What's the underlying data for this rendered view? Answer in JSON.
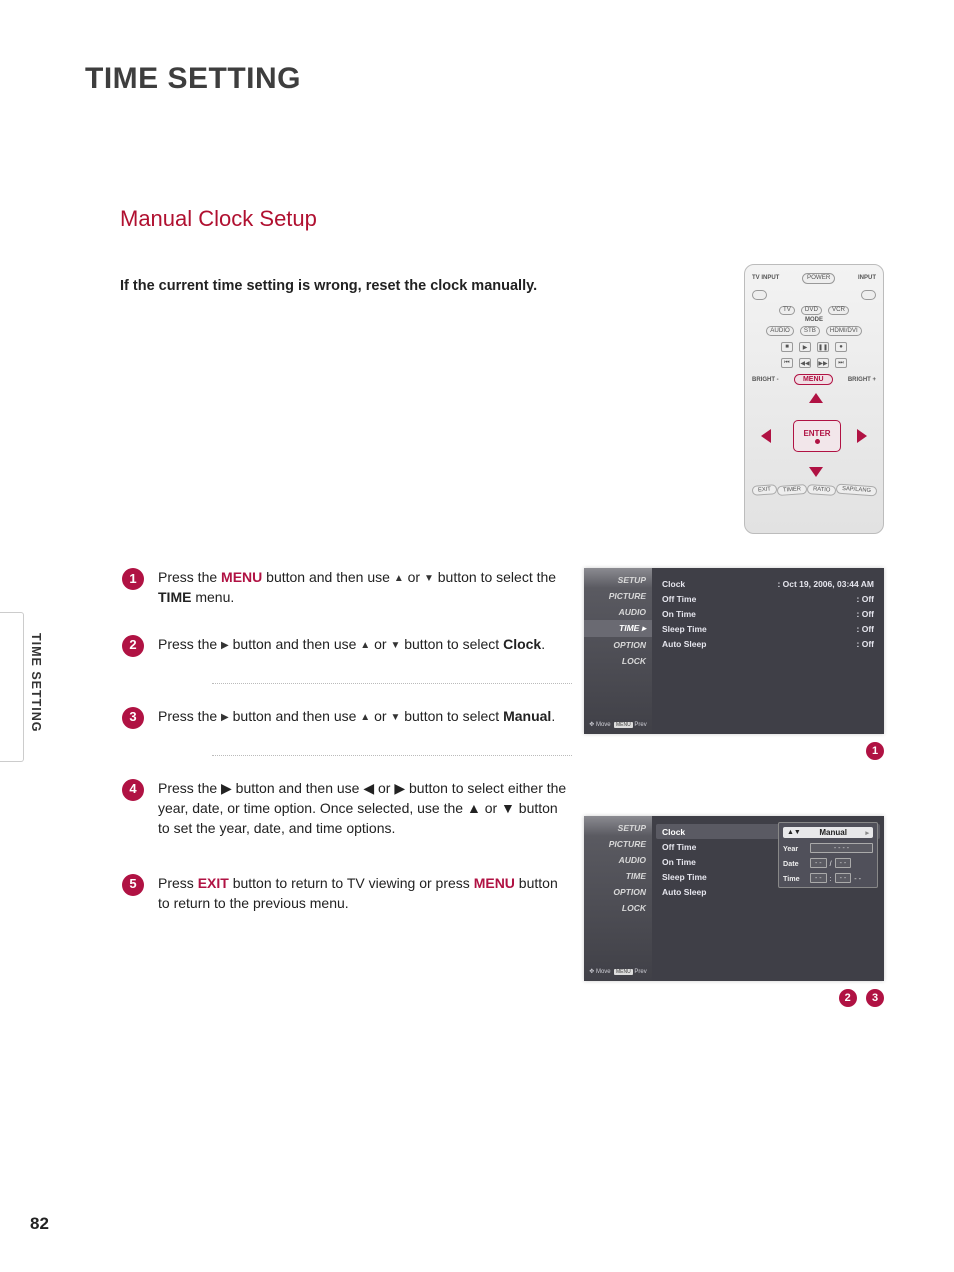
{
  "page": {
    "title": "TIME SETTING",
    "subtitle": "Manual Clock Setup",
    "intro": "If the current time setting is wrong, reset the clock manually.",
    "sidebar_label": "TIME SETTING",
    "page_number": "82"
  },
  "steps": [
    {
      "n": "1",
      "pre": "Press the ",
      "hl": "MENU",
      "mid": " button and then use ",
      "post": " button to select the ",
      "bold": "TIME",
      "tail": " menu."
    },
    {
      "n": "2",
      "pre": "Press the ",
      "mid": " button and then use ",
      "post": " button to select ",
      "bold": "Clock",
      "tail": "."
    },
    {
      "n": "3",
      "pre": "Press the ",
      "mid": " button and then use ",
      "post": " button to select ",
      "bold": "Manual",
      "tail": "."
    },
    {
      "n": "4",
      "text": "Press the ▶ button and then use ◀ or ▶ button to select either the year, date, or time option. Once selected, use the ▲ or ▼ button to set the year, date, and time options."
    },
    {
      "n": "5",
      "pre": "Press ",
      "hl": "EXIT",
      "mid": " button to return to TV viewing or press ",
      "hl2": "MENU",
      "tail": " button to return to the previous menu."
    }
  ],
  "remote": {
    "top_left": "TV INPUT",
    "power": "POWER",
    "top_right": "INPUT",
    "mode": "MODE",
    "row2": [
      "TV",
      "DVD",
      "VCR"
    ],
    "row3": [
      "AUDIO",
      "STB",
      "HDMI/DVI"
    ],
    "bright_minus": "BRIGHT -",
    "menu": "MENU",
    "bright_plus": "BRIGHT +",
    "enter": "ENTER",
    "bottom": [
      "EXIT",
      "TIMER",
      "RATIO",
      "SAP/LANG"
    ]
  },
  "osd_menu": [
    "SETUP",
    "PICTURE",
    "AUDIO",
    "TIME",
    "OPTION",
    "LOCK"
  ],
  "osd_hint": "Move        Prev",
  "osd_move": "Move",
  "osd_prev": "MENU",
  "osd1": {
    "rows": [
      {
        "k": "Clock",
        "v": ": Oct 19, 2006, 03:44 AM"
      },
      {
        "k": "Off Time",
        "v": ": Off"
      },
      {
        "k": "On Time",
        "v": ": Off"
      },
      {
        "k": "Sleep Time",
        "v": ": Off"
      },
      {
        "k": "Auto Sleep",
        "v": ": Off"
      }
    ],
    "callouts": [
      "1"
    ]
  },
  "osd2": {
    "rows": [
      {
        "k": "Clock",
        "sel": true
      },
      {
        "k": "Off Time"
      },
      {
        "k": "On Time"
      },
      {
        "k": "Sleep Time"
      },
      {
        "k": "Auto Sleep"
      }
    ],
    "manual": {
      "head": "Manual",
      "year_label": "Year",
      "year_val": "- - - -",
      "date_label": "Date",
      "date_a": "- -",
      "date_sep": "/",
      "date_b": "- -",
      "time_label": "Time",
      "time_a": "- -",
      "time_sep": ":",
      "time_b": "- -",
      "time_c": "- -"
    },
    "callouts": [
      "2",
      "3"
    ]
  },
  "glyphs": {
    "up": "▲",
    "down": "▼",
    "left": "◀",
    "right": "▶"
  }
}
